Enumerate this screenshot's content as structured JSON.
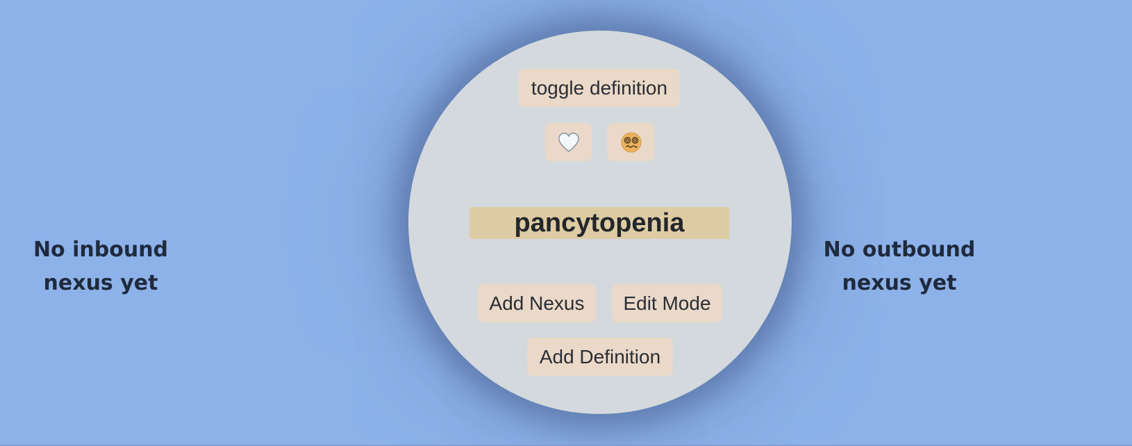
{
  "inbound": {
    "line1": "No inbound",
    "line2": "nexus yet"
  },
  "outbound": {
    "line1": "No outbound",
    "line2": "nexus yet"
  },
  "card": {
    "toggle_label": "toggle definition",
    "heart_icon": "white-heart-icon",
    "dizzy_icon": "dizzy-face-icon",
    "term": "pancytopenia",
    "add_nexus_label": "Add Nexus",
    "edit_mode_label": "Edit Mode",
    "add_definition_label": "Add Definition"
  },
  "colors": {
    "background": "#8db2ea",
    "circle": "#d4d9de",
    "button": "#ead9c9",
    "term_highlight": "#decca4",
    "text": "#1f2a3d"
  }
}
